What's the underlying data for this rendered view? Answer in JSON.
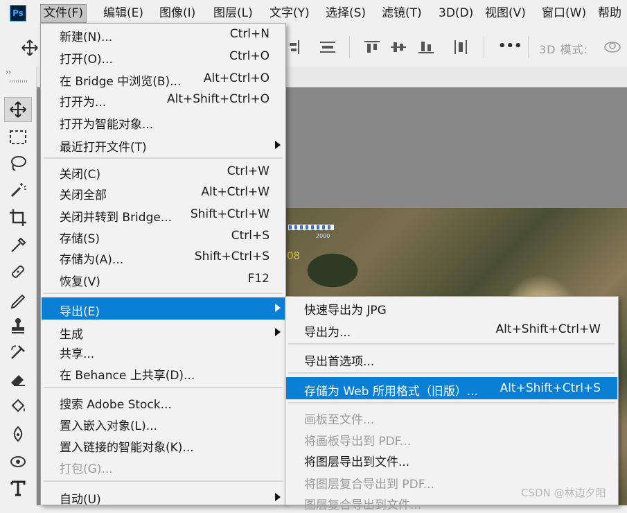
{
  "app": {
    "logo_text": "Ps"
  },
  "menubar": [
    {
      "label": "文件(F)",
      "active": true
    },
    {
      "label": "编辑(E)"
    },
    {
      "label": "图像(I)"
    },
    {
      "label": "图层(L)"
    },
    {
      "label": "文字(Y)"
    },
    {
      "label": "选择(S)"
    },
    {
      "label": "滤镜(T)"
    },
    {
      "label": "3D(D)"
    },
    {
      "label": "视图(V)"
    },
    {
      "label": "窗口(W)"
    },
    {
      "label": "帮助"
    }
  ],
  "options_bar": {
    "mode_3d": "3D 模式:",
    "more": "•••"
  },
  "tool_panel": {
    "collapse": "››"
  },
  "file_menu": [
    {
      "label": "新建(N)...",
      "shortcut": "Ctrl+N"
    },
    {
      "label": "打开(O)...",
      "shortcut": "Ctrl+O"
    },
    {
      "label": "在 Bridge 中浏览(B)...",
      "shortcut": "Alt+Ctrl+O"
    },
    {
      "label": "打开为...",
      "shortcut": "Alt+Shift+Ctrl+O"
    },
    {
      "label": "打开为智能对象...",
      "shortcut": ""
    },
    {
      "label": "最近打开文件(T)",
      "shortcut": "",
      "submenu": true
    },
    {
      "label": "关闭(C)",
      "shortcut": "Ctrl+W"
    },
    {
      "label": "关闭全部",
      "shortcut": "Alt+Ctrl+W"
    },
    {
      "label": "关闭并转到 Bridge...",
      "shortcut": "Shift+Ctrl+W"
    },
    {
      "label": "存储(S)",
      "shortcut": "Ctrl+S"
    },
    {
      "label": "存储为(A)...",
      "shortcut": "Shift+Ctrl+S"
    },
    {
      "label": "恢复(V)",
      "shortcut": "F12"
    },
    {
      "label": "导出(E)",
      "shortcut": "",
      "submenu": true,
      "highlighted": true
    },
    {
      "label": "生成",
      "shortcut": "",
      "submenu": true
    },
    {
      "label": "共享...",
      "shortcut": ""
    },
    {
      "label": "在 Behance 上共享(D)...",
      "shortcut": ""
    },
    {
      "label": "搜索 Adobe Stock...",
      "shortcut": ""
    },
    {
      "label": "置入嵌入对象(L)...",
      "shortcut": ""
    },
    {
      "label": "置入链接的智能对象(K)...",
      "shortcut": ""
    },
    {
      "label": "打包(G)...",
      "shortcut": "",
      "disabled": true
    },
    {
      "label": "自动(U)",
      "shortcut": "",
      "submenu": true
    }
  ],
  "export_submenu": [
    {
      "label": "快速导出为 JPG",
      "shortcut": ""
    },
    {
      "label": "导出为...",
      "shortcut": "Alt+Shift+Ctrl+W"
    },
    {
      "label": "导出首选项...",
      "shortcut": ""
    },
    {
      "label": "存储为 Web 所用格式（旧版）...",
      "shortcut": "Alt+Shift+Ctrl+S",
      "highlighted": true
    },
    {
      "label": "画板至文件...",
      "shortcut": "",
      "disabled": true
    },
    {
      "label": "将画板导出到 PDF...",
      "shortcut": "",
      "disabled": true
    },
    {
      "label": "将图层导出到文件...",
      "shortcut": ""
    },
    {
      "label": "将图层复合导出到 PDF...",
      "shortcut": "",
      "disabled": true
    },
    {
      "label": "图层复合导出到文件...",
      "shortcut": "",
      "disabled": true
    }
  ],
  "canvas_overlay": {
    "scale_label": "2000",
    "number_label": "08"
  },
  "watermark": "CSDN @林边夕阳",
  "colors": {
    "highlight": "#0a7fd6",
    "canvas_bg": "#888888",
    "menu_bg": "#f2f2f2"
  }
}
